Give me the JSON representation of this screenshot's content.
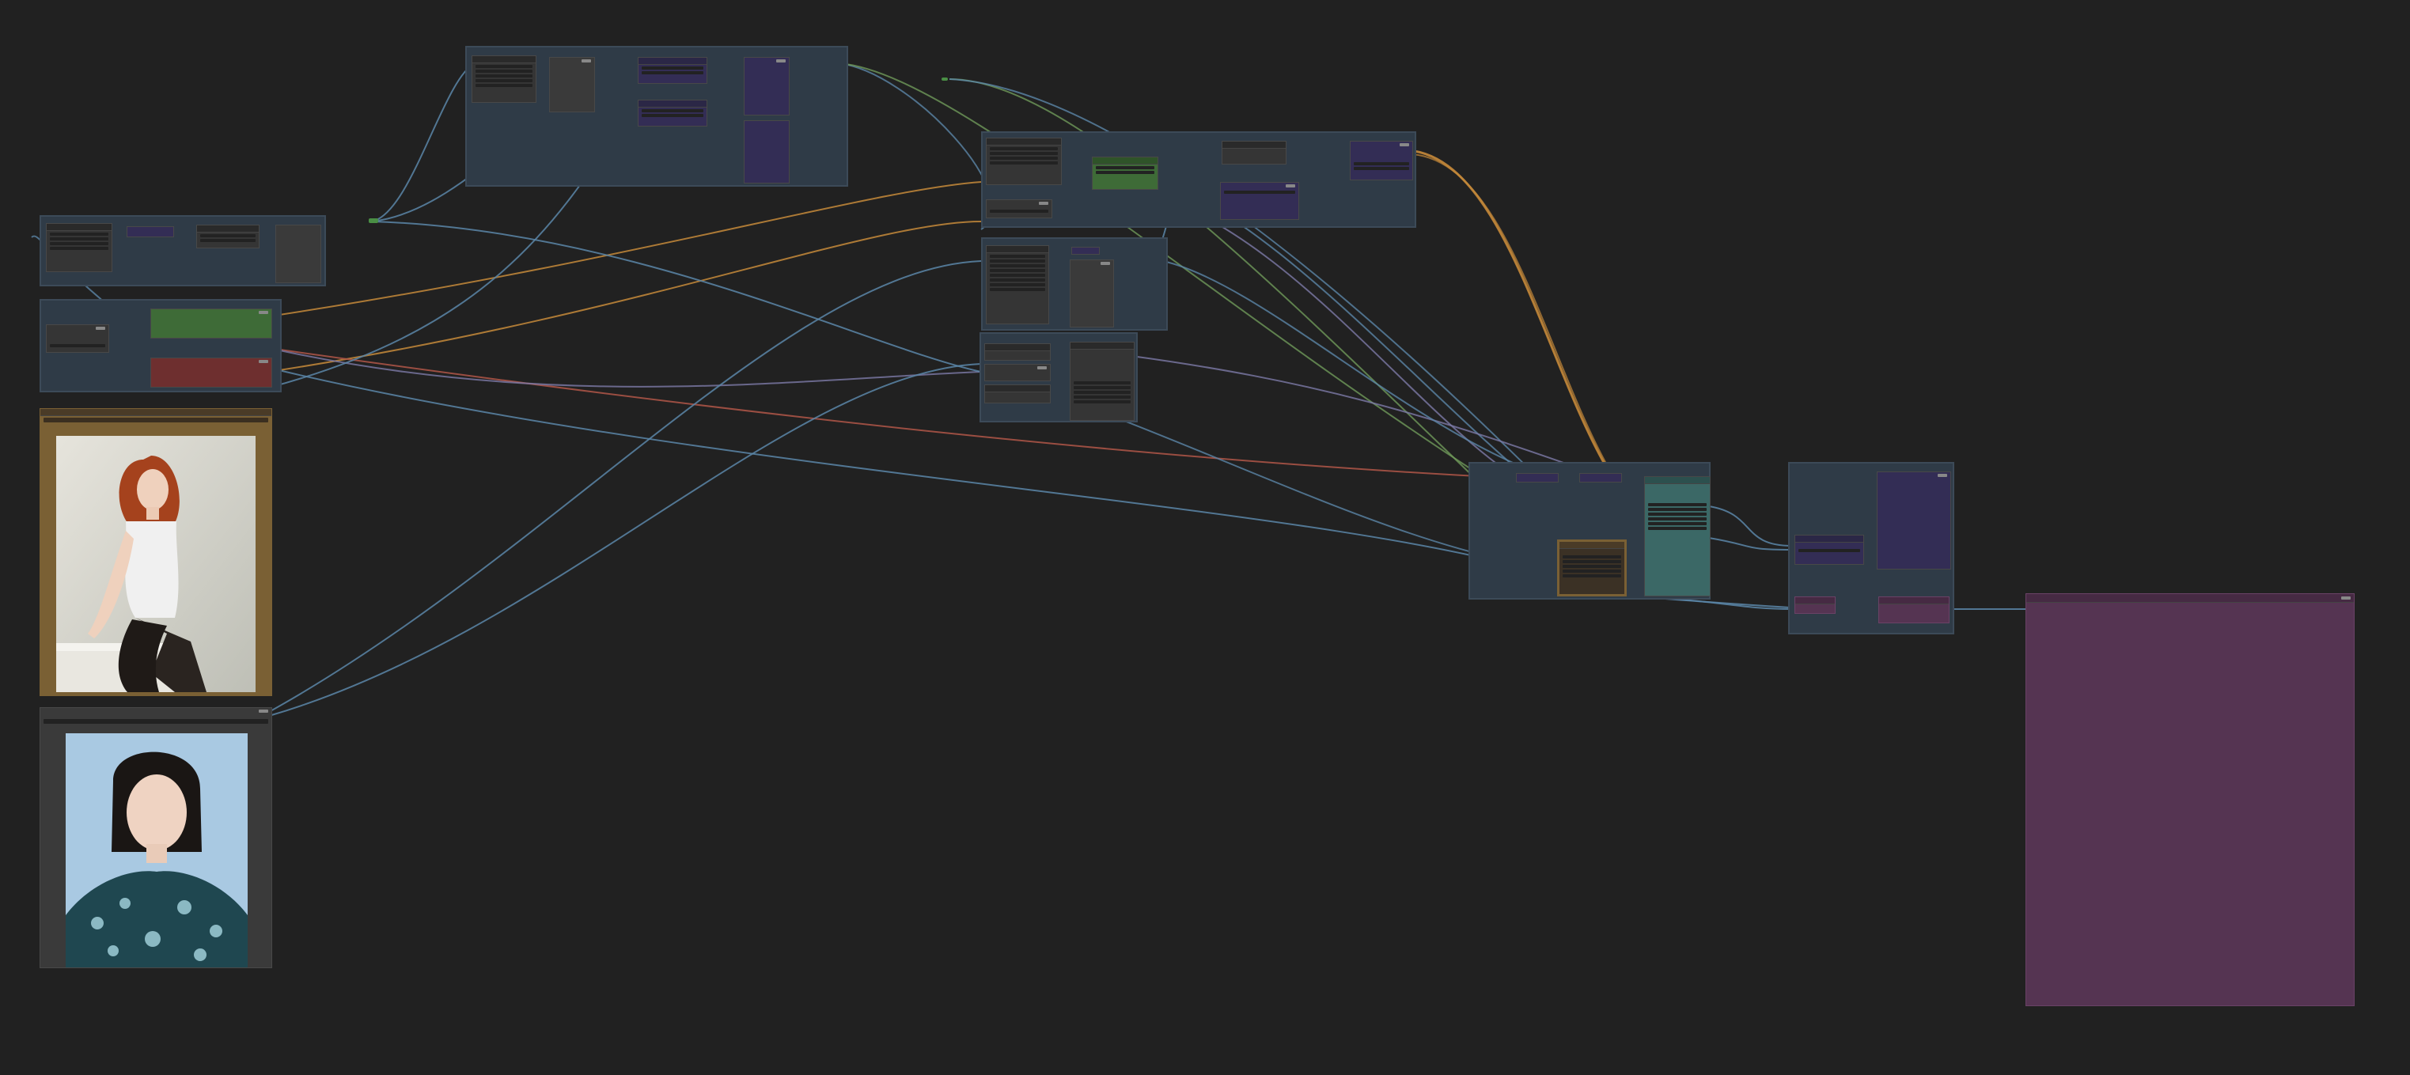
{
  "app": {
    "name": "",
    "canvas_background": "#212121"
  },
  "colors": {
    "group_fill": "#2f3b47",
    "link_blue": "#5b86a8",
    "link_orange": "#c68a3a",
    "link_red": "#b05648",
    "link_green": "#6f9a5a",
    "node_purple": "#332d55",
    "node_green": "#3e6b37",
    "node_red": "#6e2f2f",
    "node_teal": "#3b6866",
    "node_magenta": "#553452",
    "image_frame_gold": "#7a6034"
  },
  "groups": [
    {
      "id": "g-top-mid"
    },
    {
      "id": "g-left-top"
    },
    {
      "id": "g-left-prompts"
    },
    {
      "id": "g-center-top"
    },
    {
      "id": "g-center-mid"
    },
    {
      "id": "g-center-low"
    },
    {
      "id": "g-sampler"
    },
    {
      "id": "g-decode"
    }
  ],
  "images": [
    {
      "id": "image-redhead",
      "icon": "photo-woman-red-hair"
    },
    {
      "id": "image-portrait",
      "icon": "photo-woman-dark-hair"
    }
  ],
  "preview": {
    "id": "preview-image-output",
    "icon": "empty-preview"
  }
}
